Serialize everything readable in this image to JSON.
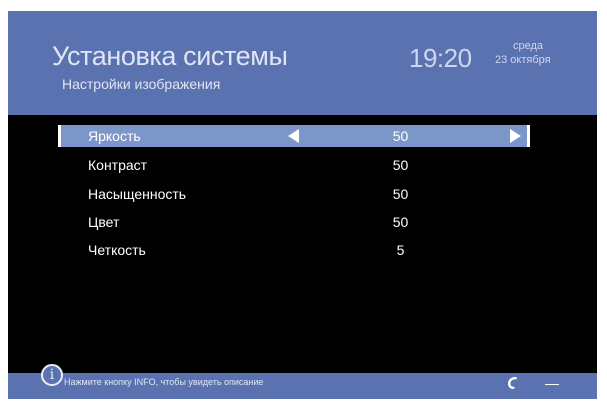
{
  "header": {
    "title": "Установка системы",
    "subtitle": "Настройки изображения",
    "time": "19:20",
    "day": "среда",
    "date": "23 октября"
  },
  "menu": {
    "items": [
      {
        "label": "Яркость",
        "value": "50",
        "selected": true
      },
      {
        "label": "Контраст",
        "value": "50",
        "selected": false
      },
      {
        "label": "Насыщенность",
        "value": "50",
        "selected": false
      },
      {
        "label": "Цвет",
        "value": "50",
        "selected": false
      },
      {
        "label": "Четкость",
        "value": "5",
        "selected": false
      }
    ]
  },
  "footer": {
    "info_glyph": "i",
    "hint": "Нажмите кнопку INFO, чтобы увидеть описание"
  },
  "icons": {
    "info": "info-icon",
    "arrow_left": "arrow-left-icon",
    "arrow_right": "arrow-right-icon",
    "logo": "rostelecom-logo-icon"
  },
  "colors": {
    "header_bg": "#5b72b0",
    "selected_row": "#7d96c9",
    "screen_bg": "#000000",
    "text": "#ffffff"
  }
}
